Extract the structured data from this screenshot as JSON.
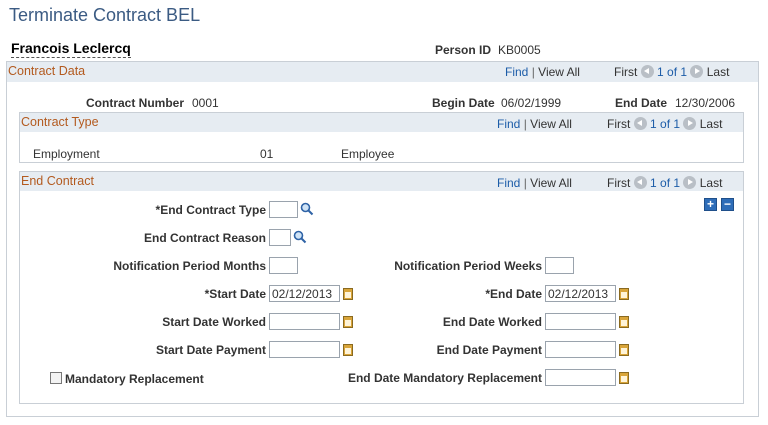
{
  "page": {
    "title": "Terminate Contract BEL"
  },
  "person": {
    "name": "Francois Leclercq",
    "id_label": "Person ID",
    "id_value": "KB0005"
  },
  "contract_data": {
    "header": "Contract Data",
    "nav": {
      "find": "Find",
      "sep": "|",
      "view_all": "View All",
      "first": "First",
      "count": "1 of 1",
      "last": "Last"
    },
    "contract_number_label": "Contract Number",
    "contract_number": "0001",
    "begin_date_label": "Begin Date",
    "begin_date": "06/02/1999",
    "end_date_label": "End Date",
    "end_date": "12/30/2006"
  },
  "contract_type": {
    "header": "Contract Type",
    "nav": {
      "find": "Find",
      "sep": "|",
      "view_all": "View All",
      "first": "First",
      "count": "1 of 1",
      "last": "Last"
    },
    "row": {
      "type": "Employment",
      "code": "01",
      "description": "Employee"
    }
  },
  "end_contract": {
    "header": "End Contract",
    "nav": {
      "find": "Find",
      "sep": "|",
      "view_all": "View All",
      "first": "First",
      "count": "1 of 1",
      "last": "Last"
    },
    "add_label": "+",
    "remove_label": "−",
    "end_contract_type_label": "*End Contract Type",
    "end_contract_type": "",
    "end_contract_reason_label": "End Contract Reason",
    "end_contract_reason": "",
    "notification_months_label": "Notification Period Months",
    "notification_months": "",
    "notification_weeks_label": "Notification Period Weeks",
    "notification_weeks": "",
    "start_date_label": "*Start Date",
    "start_date": "02/12/2013",
    "end_date_label": "*End Date",
    "end_date": "02/12/2013",
    "start_date_worked_label": "Start Date Worked",
    "start_date_worked": "",
    "end_date_worked_label": "End Date Worked",
    "end_date_worked": "",
    "start_date_payment_label": "Start Date Payment",
    "start_date_payment": "",
    "end_date_payment_label": "End Date Payment",
    "end_date_payment": "",
    "mandatory_replacement_label": "Mandatory Replacement",
    "mandatory_replacement": false,
    "end_date_mandatory_label": "End Date Mandatory Replacement",
    "end_date_mandatory": ""
  }
}
